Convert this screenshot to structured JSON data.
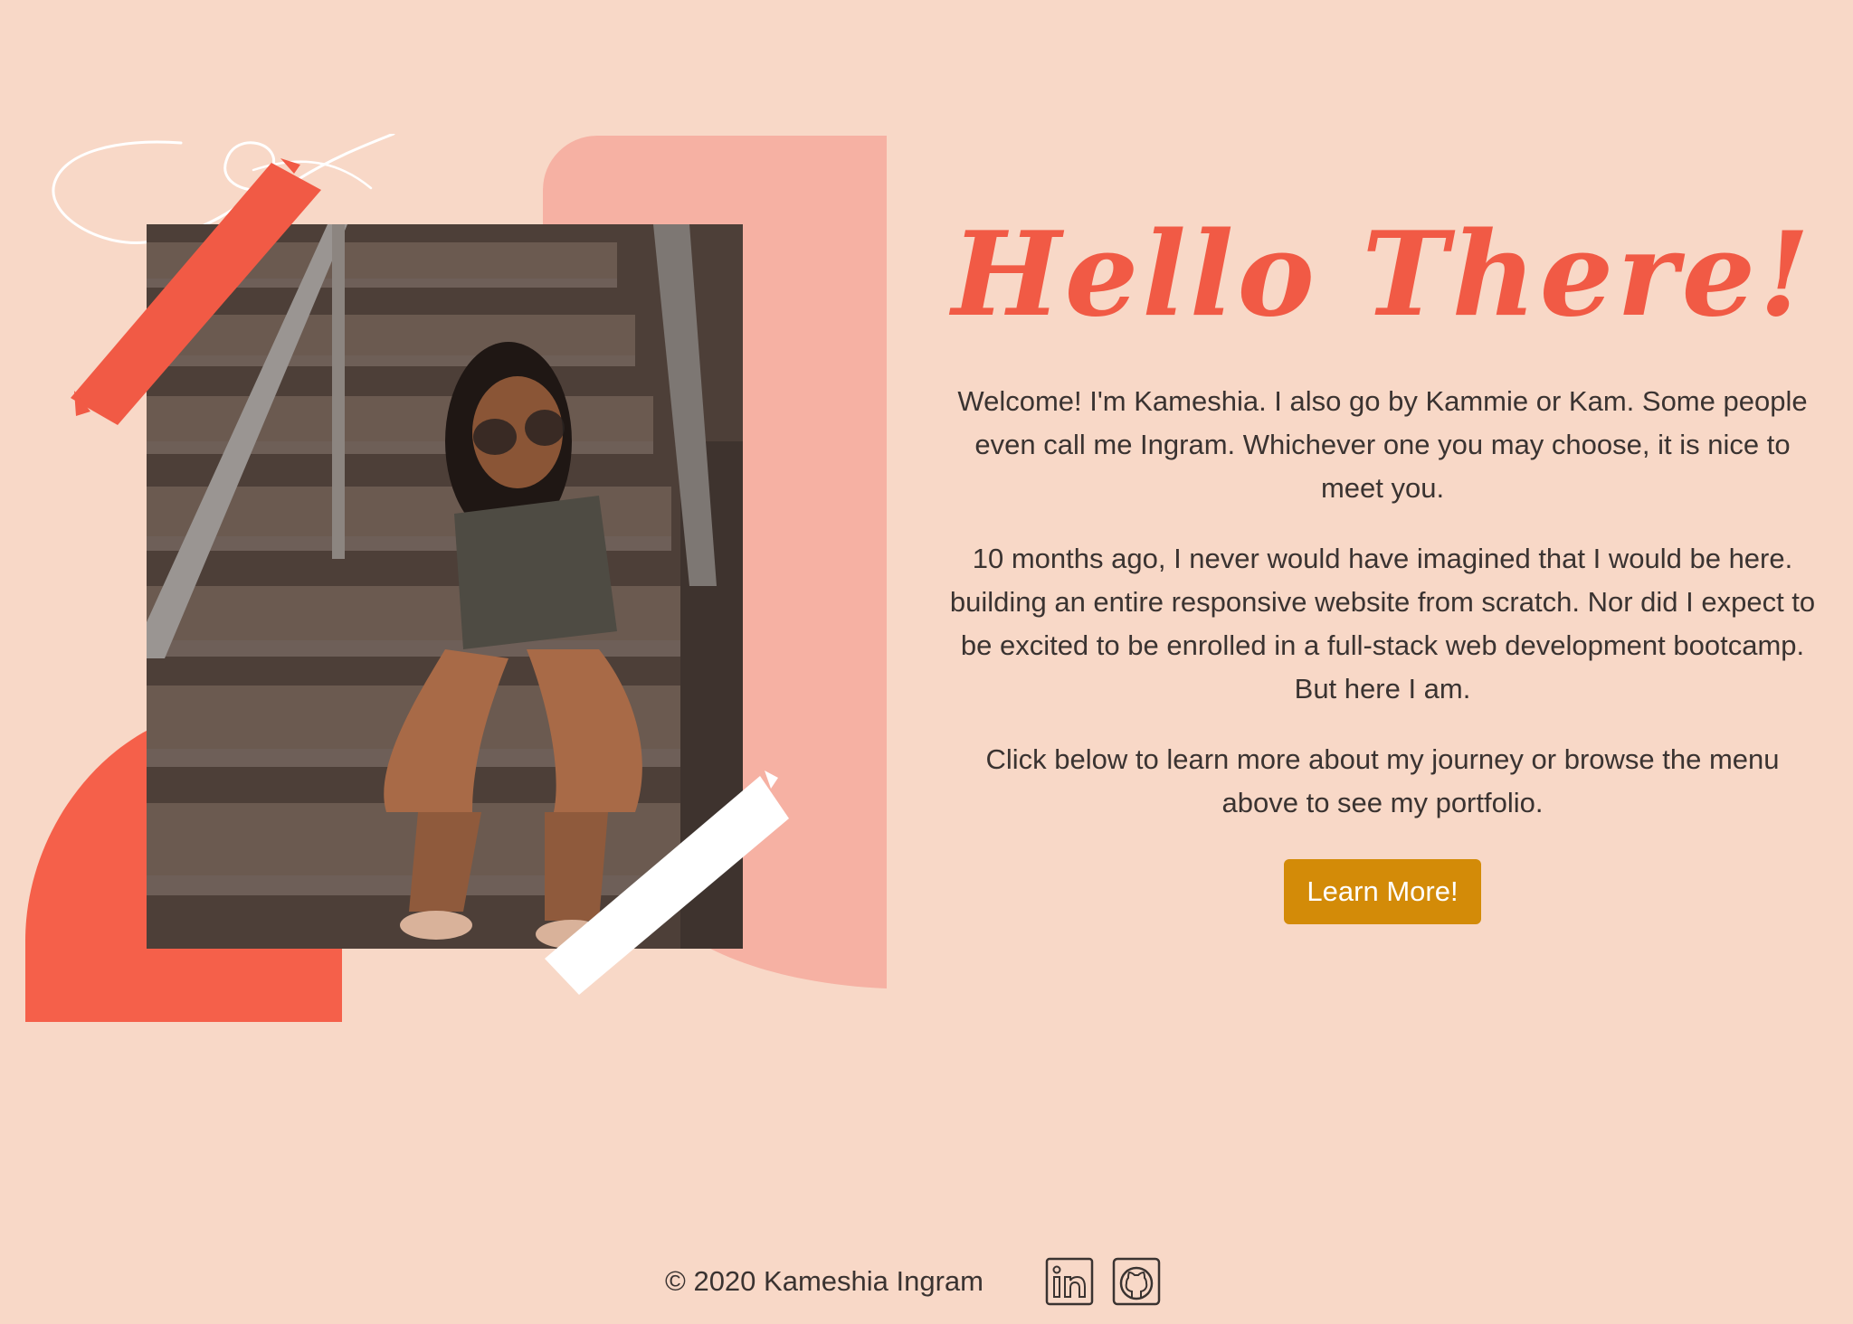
{
  "hero": {
    "title": "Hello There!",
    "paragraphs": [
      "Welcome! I'm Kameshia. I also go by Kammie or Kam. Some people even call me Ingram. Whichever one you may choose, it is nice to meet you.",
      "10 months ago, I never would have imagined that I would be here. building an entire responsive website from scratch. Nor did I expect to be excited to be enrolled in a full-stack web development bootcamp. But here I am.",
      "Click below to learn more about my journey or browse the menu above to see my portfolio."
    ],
    "button_label": "Learn More!"
  },
  "footer": {
    "copyright": "© 2020 Kameshia Ingram",
    "social": [
      {
        "icon": "linkedin-icon"
      },
      {
        "icon": "github-icon"
      }
    ]
  },
  "colors": {
    "background": "#f8d8c7",
    "accent": "#f15a45",
    "button": "#d38b08",
    "pink_blob": "#f6b1a3"
  }
}
